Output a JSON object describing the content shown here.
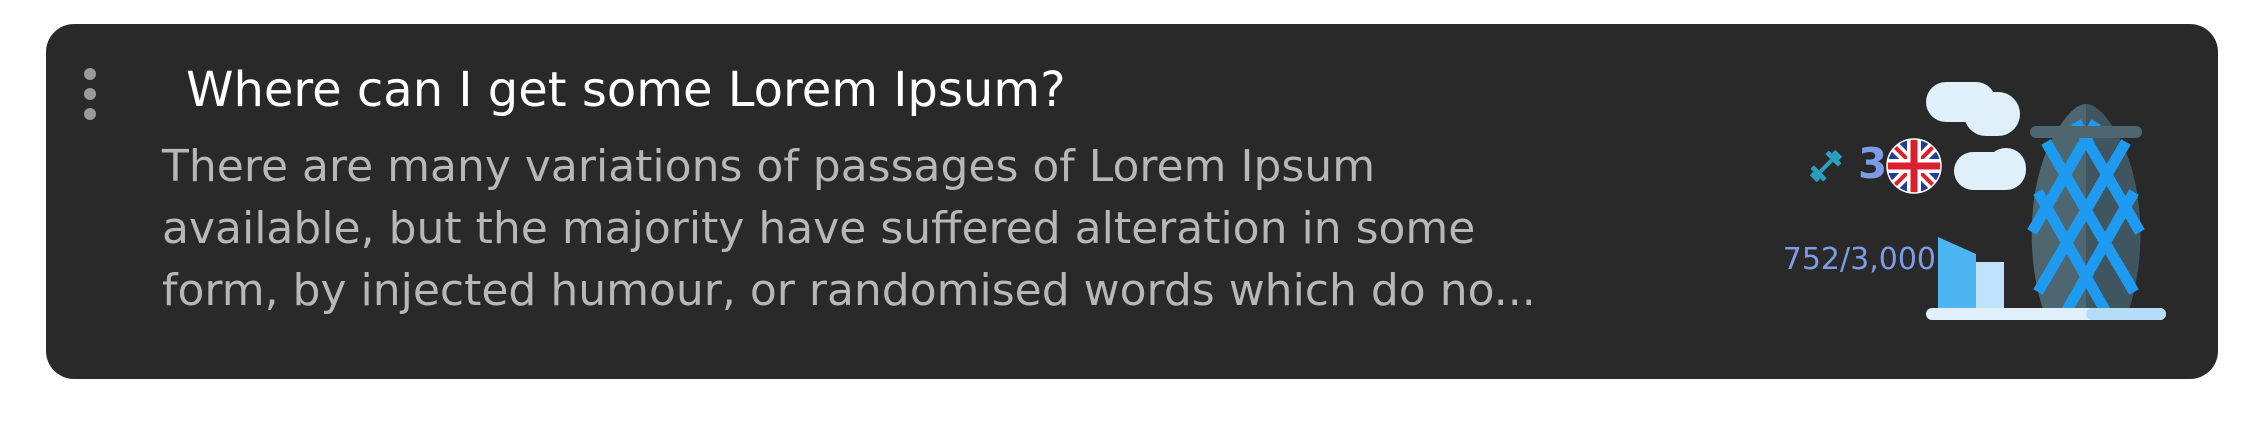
{
  "card": {
    "title": "Where can I get some Lorem Ipsum?",
    "description": "There are many variations of passages of Lorem Ipsum\navailable, but the majority have suffered alteration in some\nform, by injected humour, or randomised words which do no...",
    "level": "3",
    "progress": "752/3,000",
    "language_flag": "uk-flag-icon",
    "exercise_icon": "dumbbell-icon",
    "illustration_icon": "city-skyscraper-illustration",
    "colors": {
      "card_background": "#292929",
      "title": "#ffffff",
      "description": "#b7b7b7",
      "meta_accent": "#7e9be8",
      "dumbbell": "#2a9fbf"
    }
  }
}
